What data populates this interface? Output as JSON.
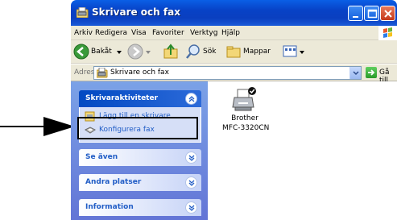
{
  "window": {
    "title": "Skrivare och fax"
  },
  "menubar": {
    "items": [
      "Arkiv",
      "Redigera",
      "Visa",
      "Favoriter",
      "Verktyg",
      "Hjälp"
    ]
  },
  "toolbar": {
    "back_label": "Bakåt",
    "search_label": "Sök",
    "folders_label": "Mappar"
  },
  "addressbar": {
    "label": "Adress",
    "value": "Skrivare och fax",
    "go_label": "Gå till"
  },
  "taskpane": {
    "printer_tasks": {
      "title": "Skrivaraktiviteter",
      "items": [
        "Lägg till en skrivare",
        "Konfigurera fax"
      ]
    },
    "see_also": {
      "title": "Se även"
    },
    "other_places": {
      "title": "Andra platser"
    },
    "details": {
      "title": "Information"
    }
  },
  "content": {
    "printers": [
      {
        "name_line1": "Brother",
        "name_line2": "MFC-3320CN",
        "is_default": true
      }
    ]
  },
  "colors": {
    "titlebar": "#0a5fe6",
    "taskpane_bg": "#7ba2e7",
    "link": "#215dc6",
    "callout": "#000000"
  }
}
